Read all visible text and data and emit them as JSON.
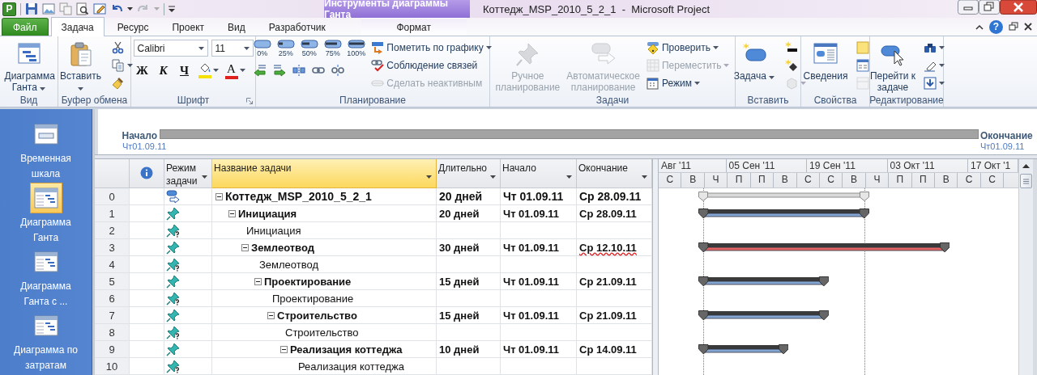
{
  "window": {
    "app_badge": "P",
    "title": "Коттедж_MSP_2010_5_2_1  -  Microsoft Project",
    "context_group": "Инструменты диаграммы Ганта",
    "help": "?"
  },
  "tabs": [
    {
      "kind": "file",
      "label": "Файл",
      "selected": false
    },
    {
      "kind": "tab",
      "label": "Задача",
      "selected": true
    },
    {
      "kind": "tab",
      "label": "Ресурс",
      "selected": false
    },
    {
      "kind": "tab",
      "label": "Проект",
      "selected": false
    },
    {
      "kind": "tab",
      "label": "Вид",
      "selected": false
    },
    {
      "kind": "tab",
      "label": "Разработчик",
      "selected": false
    },
    {
      "kind": "context",
      "label": "Формат",
      "selected": false
    }
  ],
  "ribbon": {
    "groups": [
      {
        "label": "Вид",
        "items": [
          {
            "kind": "large",
            "label": "Диаграмма Ганта",
            "dropdown": true,
            "disabled": false
          }
        ]
      },
      {
        "label": "Буфер обмена",
        "items": [
          {
            "kind": "large",
            "label": "Вставить",
            "dropdown": true,
            "disabled": false
          },
          {
            "kind": "icon",
            "dropdown": false,
            "disabled": false
          },
          {
            "kind": "icon",
            "dropdown": true,
            "disabled": false
          },
          {
            "kind": "icon",
            "dropdown": false,
            "disabled": false
          }
        ]
      },
      {
        "label": "Шрифт",
        "launcher": true,
        "items": [
          {
            "kind": "font_field",
            "value": "Calibri"
          },
          {
            "kind": "size_field",
            "value": "11"
          },
          {
            "kind": "bold",
            "label": "Ж"
          },
          {
            "kind": "italic",
            "label": "К"
          },
          {
            "kind": "underline",
            "label": "Ч"
          },
          {
            "kind": "fill_color",
            "color": "#f5e100"
          },
          {
            "kind": "font_color",
            "label": "А",
            "color": "#e0201c"
          }
        ]
      },
      {
        "label": "Планирование",
        "items": [
          {
            "kind": "progress",
            "label": "0%",
            "level": 0
          },
          {
            "kind": "progress",
            "label": "25%",
            "level": 0.25
          },
          {
            "kind": "progress",
            "label": "50%",
            "level": 0.5
          },
          {
            "kind": "progress",
            "label": "75%",
            "level": 0.75
          },
          {
            "kind": "progress",
            "label": "100%",
            "level": 1
          },
          {
            "kind": "tool",
            "disabled": false
          },
          {
            "kind": "tool",
            "disabled": false
          },
          {
            "kind": "tool",
            "disabled": false
          },
          {
            "kind": "tool",
            "disabled": false
          },
          {
            "kind": "tool",
            "disabled": false
          },
          {
            "kind": "small",
            "label": "Пометить по графику",
            "dropdown": true,
            "disabled": false
          },
          {
            "kind": "small",
            "label": "Соблюдение связей",
            "dropdown": false,
            "disabled": false
          },
          {
            "kind": "small",
            "label": "Сделать неактивным",
            "dropdown": false,
            "disabled": true
          }
        ]
      },
      {
        "label": "Задачи",
        "items": [
          {
            "kind": "large",
            "label": "Ручное планирование",
            "dropdown": false,
            "disabled": true
          },
          {
            "kind": "large",
            "label": "Автоматическое планирование",
            "dropdown": false,
            "disabled": true
          },
          {
            "kind": "small",
            "label": "Проверить",
            "dropdown": true,
            "disabled": false
          },
          {
            "kind": "small",
            "label": "Переместить",
            "dropdown": true,
            "disabled": true
          },
          {
            "kind": "small",
            "label": "Режим",
            "dropdown": true,
            "disabled": false
          }
        ]
      },
      {
        "label": "Вставить",
        "items": [
          {
            "kind": "large",
            "label": "Задача",
            "dropdown": true,
            "disabled": false
          },
          {
            "kind": "icon",
            "dropdown": false,
            "disabled": false
          },
          {
            "kind": "icon",
            "dropdown": false,
            "disabled": false
          },
          {
            "kind": "icon",
            "dropdown": true,
            "disabled": true
          }
        ]
      },
      {
        "label": "Свойства",
        "items": [
          {
            "kind": "large",
            "label": "Сведения",
            "dropdown": false,
            "disabled": false
          },
          {
            "kind": "icon",
            "dropdown": false,
            "disabled": false
          },
          {
            "kind": "icon",
            "dropdown": false,
            "disabled": false
          },
          {
            "kind": "icon",
            "dropdown": false,
            "disabled": true
          }
        ]
      },
      {
        "label": "Редактирование",
        "items": [
          {
            "kind": "large",
            "label": "Перейти к задаче",
            "dropdown": false,
            "disabled": false
          },
          {
            "kind": "icon",
            "dropdown": true,
            "disabled": false
          },
          {
            "kind": "icon",
            "dropdown": true,
            "disabled": false
          },
          {
            "kind": "icon",
            "dropdown": true,
            "disabled": false
          }
        ]
      }
    ]
  },
  "views": [
    {
      "label": "Временная шкала",
      "selected": false
    },
    {
      "label": "Диаграмма Ганта",
      "selected": true
    },
    {
      "label": "Диаграмма Ганта с ...",
      "selected": false
    },
    {
      "label": "Диаграмма по затратам",
      "selected": false
    }
  ],
  "timeline": {
    "start_label": "Начало",
    "start_date": "Чт01.09.11",
    "end_label": "Окончание",
    "end_date": "Чт01.09.11"
  },
  "table": {
    "columns": [
      {
        "kind": "row_number"
      },
      {
        "kind": "indicators"
      },
      {
        "kind": "mode",
        "label": "Режим задачи",
        "selected": false
      },
      {
        "kind": "name",
        "label": "Название задачи",
        "selected": true
      },
      {
        "kind": "duration",
        "label": "Длительно",
        "selected": false
      },
      {
        "kind": "start",
        "label": "Начало",
        "selected": false
      },
      {
        "kind": "finish",
        "label": "Окончание",
        "selected": false
      }
    ],
    "rows": [
      {
        "number": "0",
        "kind": "auto",
        "name": "Коттедж_MSP_2010_5_2_1",
        "duration": "20 дней",
        "start": "Чт 01.09.11",
        "finish": "Ср 28.09.11",
        "finish_flagged": false,
        "bar": {
          "kind": "project"
        },
        "expanded": true,
        "children": [
          {
            "number": "1",
            "kind": "manual",
            "name": "Инициация",
            "duration": "20 дней",
            "start": "Чт 01.09.11",
            "finish": "Ср 28.09.11",
            "finish_flagged": false,
            "bar": {
              "kind": "summary"
            },
            "expanded": true,
            "children": [
              {
                "number": "2",
                "kind": "manual_estimated",
                "name": "Инициация"
              },
              {
                "number": "3",
                "kind": "manual",
                "name": "Землеотвод",
                "duration": "30 дней",
                "start": "Чт 01.09.11",
                "finish": "Ср 12.10.11",
                "finish_flagged": true,
                "bar": {
                  "kind": "critical"
                },
                "expanded": true,
                "children": [
                  {
                    "number": "4",
                    "kind": "manual_estimated",
                    "name": "Землеотвод"
                  },
                  {
                    "number": "5",
                    "kind": "manual",
                    "name": "Проектирование",
                    "duration": "15 дней",
                    "start": "Чт 01.09.11",
                    "finish": "Ср 21.09.11",
                    "finish_flagged": false,
                    "bar": {
                      "kind": "summary"
                    },
                    "expanded": true,
                    "children": [
                      {
                        "number": "6",
                        "kind": "manual_estimated",
                        "name": "Проектирование"
                      },
                      {
                        "number": "7",
                        "kind": "manual",
                        "name": "Строительство",
                        "duration": "15 дней",
                        "start": "Чт 01.09.11",
                        "finish": "Ср 21.09.11",
                        "finish_flagged": false,
                        "bar": {
                          "kind": "summary"
                        },
                        "expanded": true,
                        "children": [
                          {
                            "number": "8",
                            "kind": "manual_estimated",
                            "name": "Строительство"
                          },
                          {
                            "number": "9",
                            "kind": "manual",
                            "name": "Реализация коттеджа",
                            "duration": "10 дней",
                            "start": "Чт 01.09.11",
                            "finish": "Ср 14.09.11",
                            "finish_flagged": false,
                            "bar": {
                              "kind": "summary"
                            },
                            "expanded": true,
                            "children": [
                              {
                                "number": "10",
                                "kind": "manual_estimated",
                                "name": "Реализация коттеджа"
                              }
                            ]
                          }
                        ]
                      }
                    ]
                  }
                ]
              }
            ]
          }
        ]
      }
    ]
  },
  "timescale": {
    "major": [
      "Авг '11",
      "05 Сен '11",
      "19 Сен '11",
      "03 Окт '11",
      "17 Окт '1"
    ],
    "minor": [
      "С",
      "В",
      "Ч",
      "П",
      "П",
      "В",
      "С",
      "С",
      "В",
      "Ч",
      "П",
      "П",
      "В",
      "С",
      "С"
    ]
  }
}
